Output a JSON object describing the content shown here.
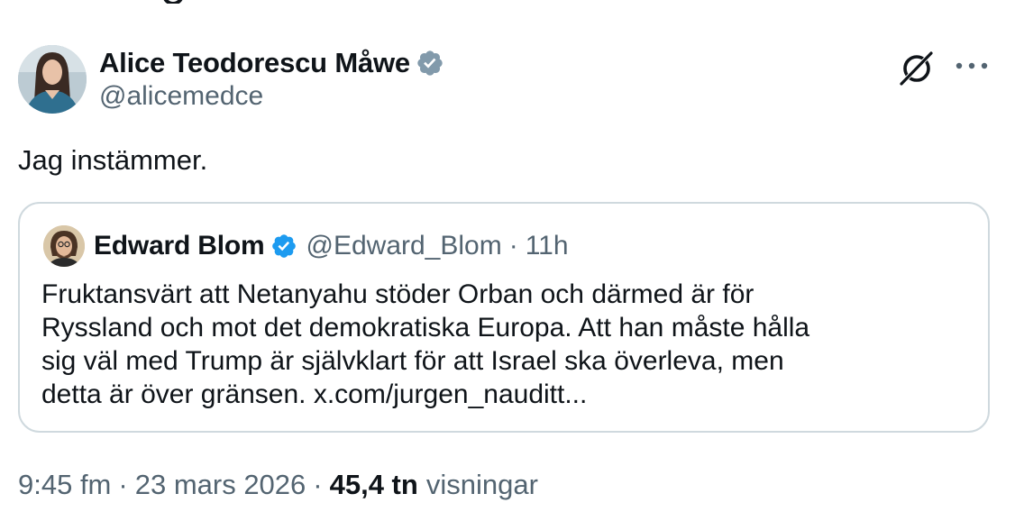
{
  "post": {
    "author": {
      "name": "Alice Teodorescu Måwe",
      "handle": "@alicemedce",
      "verified": true
    },
    "text": "Jag instämmer.",
    "icons": {
      "grok": "grok-icon",
      "more": "more-icon",
      "verified": "verified-badge-icon"
    },
    "quote": {
      "author_name": "Edward Blom",
      "author_handle": "@Edward_Blom",
      "separator": "·",
      "time": "11h",
      "lines": [
        "Fruktansvärt att Netanyahu stöder Orban och därmed är för",
        "Ryssland och mot det demokratiska Europa. Att han måste hålla",
        "sig väl med Trump är självklart för att Israel ska överleva, men",
        "detta är över gränsen. x.com/jurgen_nauditt..."
      ]
    },
    "meta": {
      "time": "9:45 fm",
      "separator": "·",
      "date": "23 mars 2026",
      "views_count": "45,4 tn",
      "views_label": "visningar"
    }
  },
  "colors": {
    "text": "#0f1419",
    "secondary": "#536471",
    "verified_blue": "#1d9bf0",
    "verified_gray": "#829aab",
    "border": "#cfd9de"
  }
}
